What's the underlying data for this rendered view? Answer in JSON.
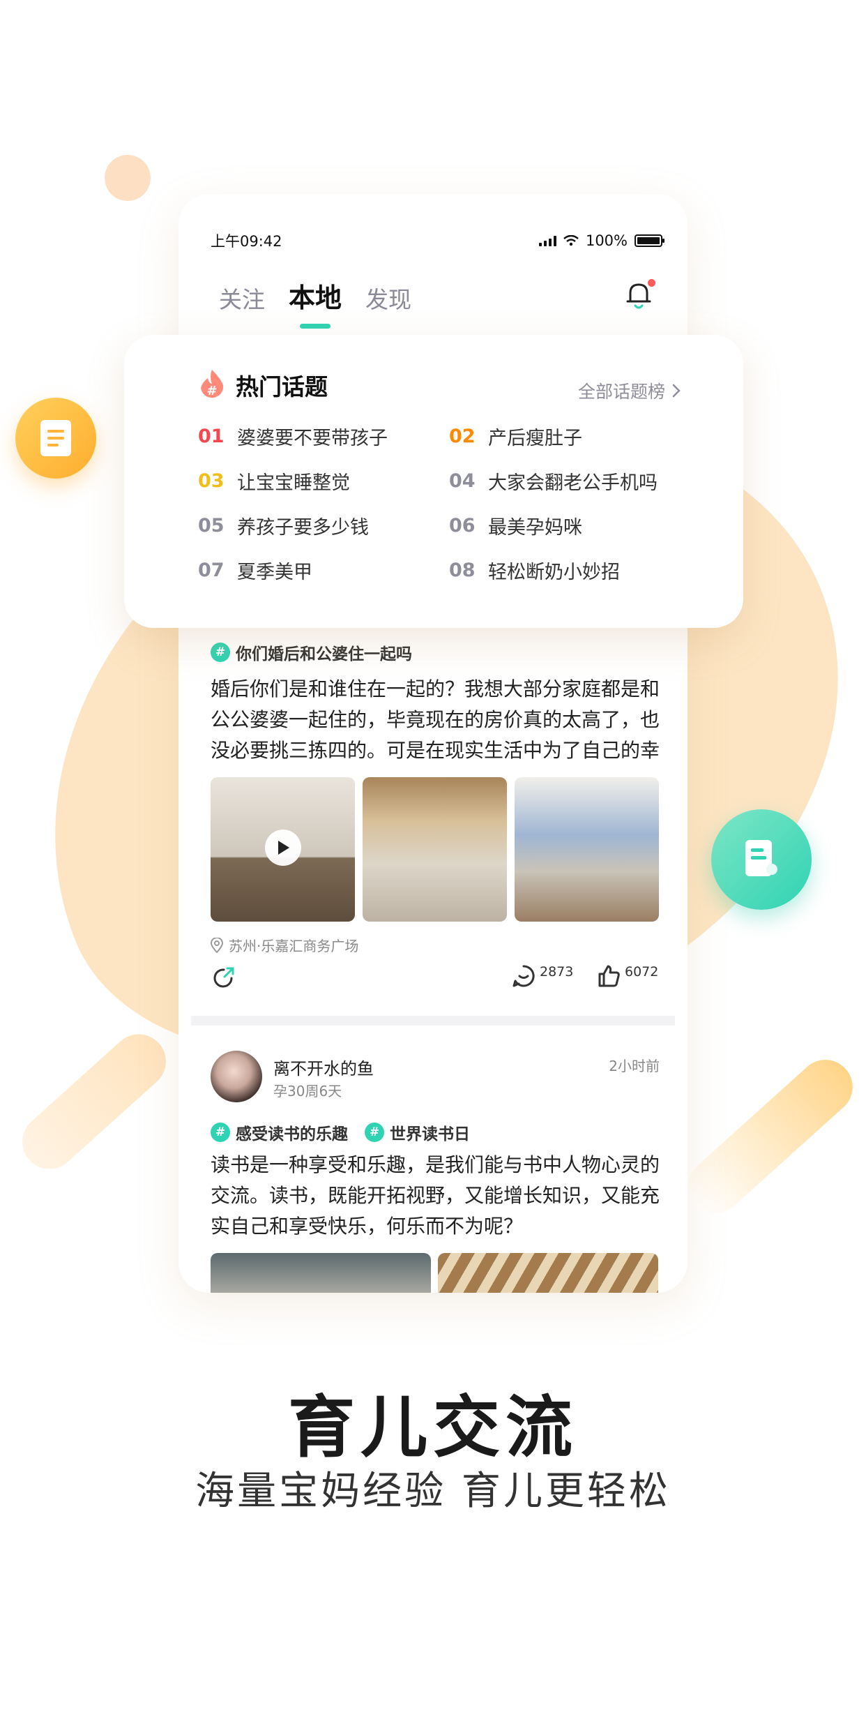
{
  "status_bar": {
    "time": "上午09:42",
    "battery": "100%"
  },
  "tabs": [
    {
      "label": "关注",
      "active": false
    },
    {
      "label": "本地",
      "active": true
    },
    {
      "label": "发现",
      "active": false
    }
  ],
  "hot_topics": {
    "title": "热门话题",
    "all_label": "全部话题榜",
    "items": [
      {
        "rank": "01",
        "text": "婆婆要不要带孩子",
        "color": "#f5474f"
      },
      {
        "rank": "02",
        "text": "产后瘦肚子",
        "color": "#ff8a00"
      },
      {
        "rank": "03",
        "text": "让宝宝睡整觉",
        "color": "#f0be17"
      },
      {
        "rank": "04",
        "text": "大家会翻老公手机吗",
        "color": "#8e8e9a"
      },
      {
        "rank": "05",
        "text": "养孩子要多少钱",
        "color": "#8e8e9a"
      },
      {
        "rank": "06",
        "text": "最美孕妈咪",
        "color": "#8e8e9a"
      },
      {
        "rank": "07",
        "text": "夏季美甲",
        "color": "#8e8e9a"
      },
      {
        "rank": "08",
        "text": "轻松断奶小妙招",
        "color": "#8e8e9a"
      }
    ]
  },
  "post1": {
    "tag": "你们婚后和公婆住一起吗",
    "text": "婚后你们是和谁住在一起的？我想大部分家庭都是和公公婆婆一起住的，毕竟现在的房价真的太高了，也没必要挑三拣四的。可是在现实生活中为了自己的幸",
    "location": "苏州·乐嘉汇商务广场",
    "comments": "2873",
    "likes": "6072"
  },
  "post2": {
    "username": "离不开水的鱼",
    "meta": "孕30周6天",
    "time": "2小时前",
    "tags": [
      "感受读书的乐趣",
      "世界读书日"
    ],
    "text": "读书是一种享受和乐趣，是我们能与书中人物心灵的交流。读书，既能开拓视野，又能增长知识，又能充实自己和享受快乐，何乐而不为呢？"
  },
  "caption": {
    "title": "育儿交流",
    "subtitle": "海量宝妈经验 育儿更轻松"
  },
  "colors": {
    "accent": "#2fd3b2",
    "orange": "#ffae2e",
    "bg_blob": "#fde5c3"
  },
  "icons": [
    "document-icon",
    "bell-icon",
    "flame-hash-icon",
    "chevron-right-icon",
    "play-icon",
    "location-pin-icon",
    "share-icon",
    "comment-icon",
    "like-icon",
    "note-icon"
  ]
}
